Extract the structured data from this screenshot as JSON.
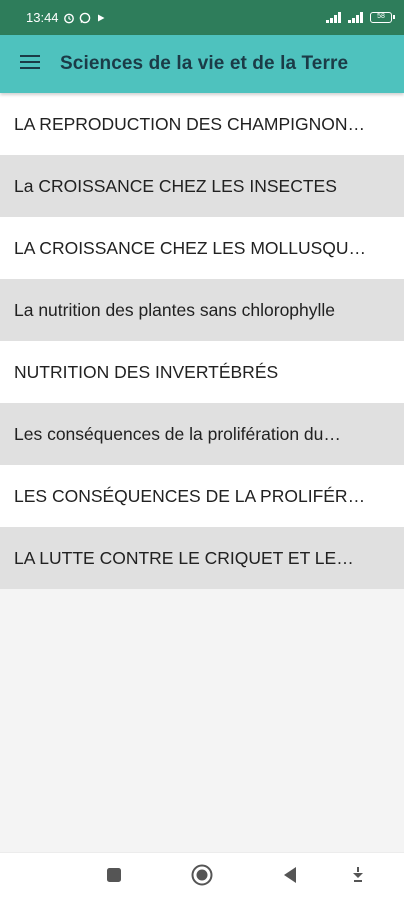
{
  "status_bar": {
    "time": "13:44",
    "battery": "58"
  },
  "app_bar": {
    "title": "Sciences de la vie et de la Terre",
    "menu_icon": "hamburger-menu-icon"
  },
  "list": {
    "items": [
      {
        "label": "LA REPRODUCTION DES CHAMPIGNON…"
      },
      {
        "label": "La CROISSANCE CHEZ LES INSECTES"
      },
      {
        "label": "LA CROISSANCE CHEZ LES MOLLUSQU…"
      },
      {
        "label": "La nutrition des plantes sans chlorophylle"
      },
      {
        "label": "NUTRITION DES INVERTÉBRÉS"
      },
      {
        "label": "Les conséquences de la prolifération du…"
      },
      {
        "label": "LES CONSÉQUENCES DE LA PROLIFÉR…"
      },
      {
        "label": "LA LUTTE CONTRE LE CRIQUET ET LE…"
      }
    ]
  },
  "nav_bar": {
    "icons": [
      "recents-square-icon",
      "home-circle-icon",
      "back-triangle-icon",
      "notification-pull-icon"
    ]
  },
  "colors": {
    "status_bar": "#2e7d5b",
    "app_bar": "#4ec2be",
    "row_alt": "#e0e0e0",
    "title_text": "#1b3b47"
  }
}
